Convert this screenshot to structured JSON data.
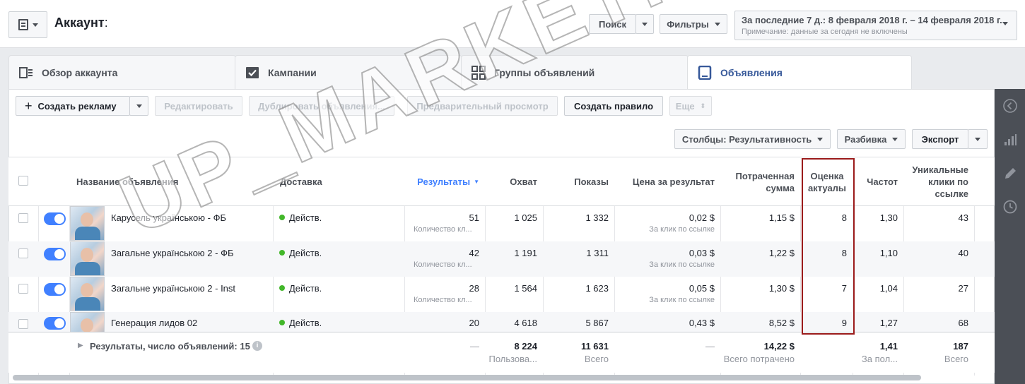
{
  "header": {
    "account_label": "Аккаунт",
    "account_colon": ":",
    "search_label": "Поиск",
    "filters_label": "Фильтры",
    "date_range": "За последние 7 д.: 8 февраля 2018 г. – 14 февраля 2018 г.",
    "date_note": "Примечание: данные за сегодня не включены"
  },
  "tabs": [
    {
      "label": "Обзор аккаунта",
      "icon": "account-overview-icon",
      "active": false
    },
    {
      "label": "Кампании",
      "icon": "checkbox-icon",
      "active": false
    },
    {
      "label": "Группы объявлений",
      "icon": "grid-icon",
      "active": false
    },
    {
      "label": "Объявления",
      "icon": "ad-monitor-icon",
      "active": true
    }
  ],
  "toolbar": {
    "create_label": "Создать рекламу",
    "edit_label": "Редактировать",
    "duplicate_label": "Дублировать объявления...",
    "preview_label": "Предварительный просмотр",
    "rule_label": "Создать правило",
    "more_label": "Еще",
    "columns_label": "Столбцы: Результативность",
    "breakdown_label": "Разбивка",
    "export_label": "Экспорт"
  },
  "table": {
    "headers": {
      "name": "Название объявления",
      "delivery": "Доставка",
      "results": "Результаты",
      "reach": "Охват",
      "impressions": "Показы",
      "cost_per_result": "Цена за результат",
      "spent_line1": "Потраченная",
      "spent_line2": "сумма",
      "score_line1": "Оценка",
      "score_line2": "актуалы",
      "frequency": "Частот",
      "unique_line1": "Уникальные",
      "unique_line2": "клики по",
      "unique_line3": "ссылке"
    },
    "rows": [
      {
        "name": "Карусель українською - ФБ",
        "delivery": "Действ.",
        "results": "51",
        "results_sub": "Количество кл...",
        "reach": "1 025",
        "impressions": "1 332",
        "cpr": "0,02 $",
        "cpr_sub": "За клик по ссылке",
        "spent": "1,15 $",
        "score": "8",
        "frequency": "1,30",
        "unique_clicks": "43"
      },
      {
        "name": "Загальне українською 2 - ФБ",
        "delivery": "Действ.",
        "results": "42",
        "results_sub": "Количество кл...",
        "reach": "1 191",
        "impressions": "1 311",
        "cpr": "0,03 $",
        "cpr_sub": "За клик по ссылке",
        "spent": "1,22 $",
        "score": "8",
        "frequency": "1,10",
        "unique_clicks": "40"
      },
      {
        "name": "Загальне українською 2 - Inst",
        "delivery": "Действ.",
        "results": "28",
        "results_sub": "Количество кл...",
        "reach": "1 564",
        "impressions": "1 623",
        "cpr": "0,05 $",
        "cpr_sub": "За клик по ссылке",
        "spent": "1,30 $",
        "score": "7",
        "frequency": "1,04",
        "unique_clicks": "27"
      },
      {
        "name": "Генерация лидов 02",
        "delivery": "Действ.",
        "results": "20",
        "results_sub": "",
        "reach": "4 618",
        "impressions": "5 867",
        "cpr": "0,43 $",
        "cpr_sub": "",
        "spent": "8,52 $",
        "score": "9",
        "frequency": "1,27",
        "unique_clicks": "68"
      }
    ],
    "footer": {
      "label": "Результаты, число объявлений: 15",
      "results": "—",
      "reach": "8 224",
      "reach_sub": "Пользова...",
      "impressions": "11 631",
      "impressions_sub": "Всего",
      "cpr": "—",
      "spent": "14,22 $",
      "spent_sub": "Всего потрачено",
      "frequency": "1,41",
      "frequency_sub": "За пол...",
      "unique_clicks": "187",
      "unique_sub": "Всего"
    }
  },
  "watermark": "UP_MARKETING",
  "colors": {
    "accent": "#365899",
    "toggle": "#4080ff",
    "active_dot": "#42b72a",
    "highlight": "#9b1b1b"
  }
}
